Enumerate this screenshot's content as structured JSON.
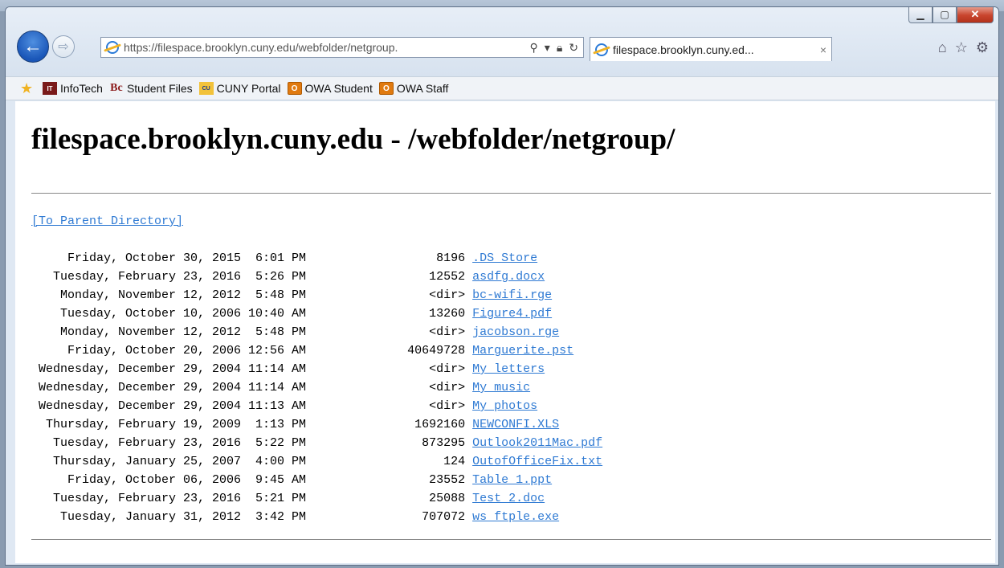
{
  "browser": {
    "url": "https://filespace.brooklyn.cuny.edu/webfolder/netgroup/",
    "url_display": "https://filespace.brooklyn.cuny.edu/webfolder/netgroup.",
    "tab_title": "filespace.brooklyn.cuny.ed...",
    "tab_close": "×",
    "back_glyph": "←",
    "forward_glyph": "⇨",
    "addr_icons": [
      "search-icon",
      "dropdown-icon",
      "lock-icon",
      "refresh-icon"
    ],
    "right_icons": [
      "home-icon",
      "favorites-star-icon",
      "gear-icon"
    ]
  },
  "favorites_bar": {
    "items": [
      {
        "label": "InfoTech",
        "icon": "infotech-icon",
        "icon_text": "IT"
      },
      {
        "label": "Student Files",
        "icon": "bc-icon",
        "icon_text": "Bc"
      },
      {
        "label": "CUNY Portal",
        "icon": "cuny-icon",
        "icon_text": "CU"
      },
      {
        "label": "OWA Student",
        "icon": "owa-icon",
        "icon_text": "O"
      },
      {
        "label": "OWA Staff",
        "icon": "owa-icon",
        "icon_text": "O"
      }
    ]
  },
  "page": {
    "title": "filespace.brooklyn.cuny.edu - /webfolder/netgroup/",
    "parent_link": "[To Parent Directory]",
    "entries": [
      {
        "date": "Friday, October 30, 2015  6:01 PM",
        "size": "8196",
        "name": ".DS Store"
      },
      {
        "date": "Tuesday, February 23, 2016  5:26 PM",
        "size": "12552",
        "name": "asdfg.docx"
      },
      {
        "date": "Monday, November 12, 2012  5:48 PM",
        "size": "<dir>",
        "name": "bc-wifi.rge"
      },
      {
        "date": "Tuesday, October 10, 2006 10:40 AM",
        "size": "13260",
        "name": "Figure4.pdf"
      },
      {
        "date": "Monday, November 12, 2012  5:48 PM",
        "size": "<dir>",
        "name": "jacobson.rge"
      },
      {
        "date": "Friday, October 20, 2006 12:56 AM",
        "size": "40649728",
        "name": "Marguerite.pst"
      },
      {
        "date": "Wednesday, December 29, 2004 11:14 AM",
        "size": "<dir>",
        "name": "My letters"
      },
      {
        "date": "Wednesday, December 29, 2004 11:14 AM",
        "size": "<dir>",
        "name": "My music"
      },
      {
        "date": "Wednesday, December 29, 2004 11:13 AM",
        "size": "<dir>",
        "name": "My photos"
      },
      {
        "date": "Thursday, February 19, 2009  1:13 PM",
        "size": "1692160",
        "name": "NEWCONFI.XLS"
      },
      {
        "date": "Tuesday, February 23, 2016  5:22 PM",
        "size": "873295",
        "name": "Outlook2011Mac.pdf"
      },
      {
        "date": "Thursday, January 25, 2007  4:00 PM",
        "size": "124",
        "name": "OutofOfficeFix.txt"
      },
      {
        "date": "Friday, October 06, 2006  9:45 AM",
        "size": "23552",
        "name": "Table 1.ppt"
      },
      {
        "date": "Tuesday, February 23, 2016  5:21 PM",
        "size": "25088",
        "name": "Test 2.doc"
      },
      {
        "date": "Tuesday, January 31, 2012  3:42 PM",
        "size": "707072",
        "name": "ws ftple.exe"
      }
    ]
  },
  "colors": {
    "link": "#2f7ad3",
    "back_button": "#1a56b8",
    "close_button": "#c9452e"
  }
}
